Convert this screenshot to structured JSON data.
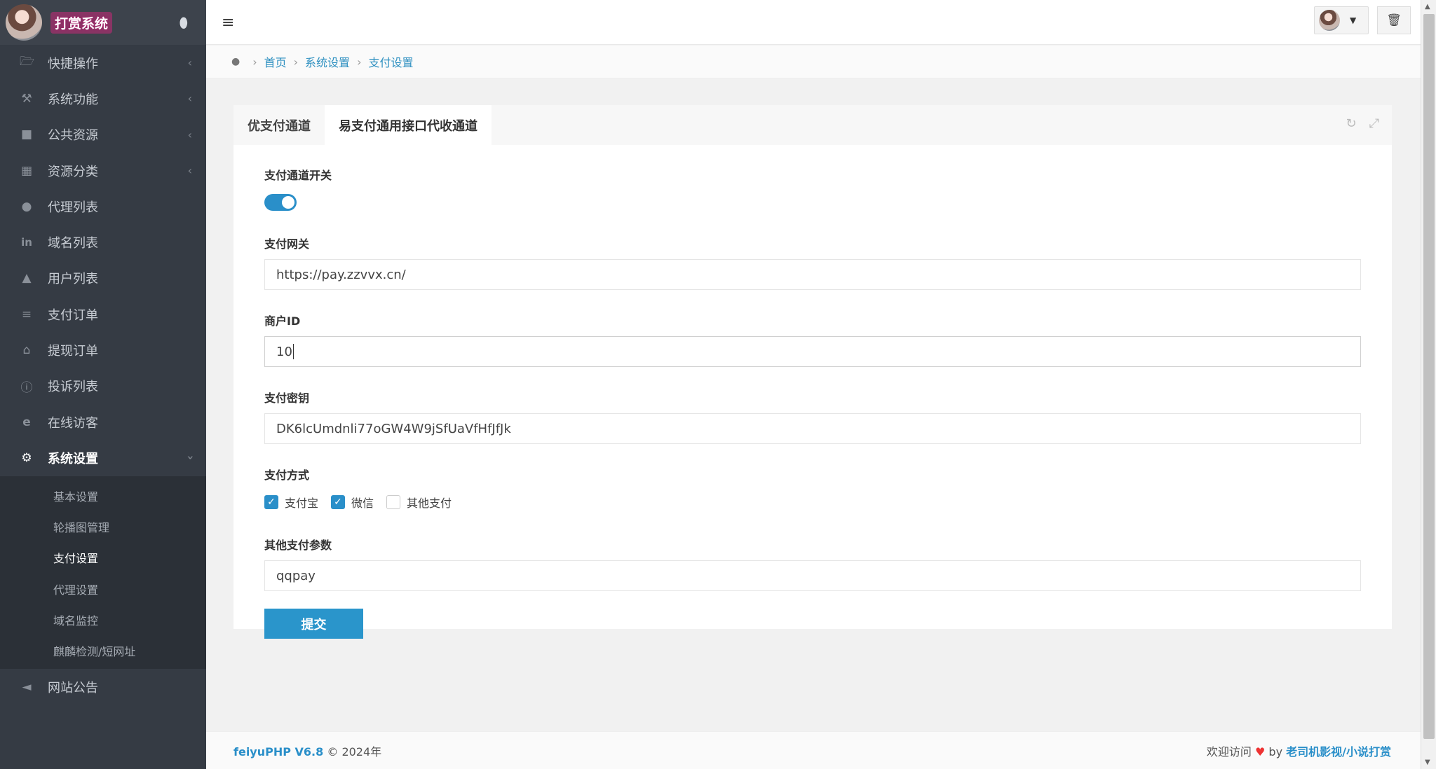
{
  "brand": {
    "title": "打赏系统"
  },
  "sidebar": {
    "items": [
      {
        "label": "快捷操作",
        "icon": "folder-icon",
        "has_arrow": true
      },
      {
        "label": "系统功能",
        "icon": "wrench-icon",
        "has_arrow": true
      },
      {
        "label": "公共资源",
        "icon": "video-camera-icon",
        "has_arrow": true
      },
      {
        "label": "资源分类",
        "icon": "grid-icon",
        "has_arrow": true
      },
      {
        "label": "代理列表",
        "icon": "users-icon",
        "has_arrow": false
      },
      {
        "label": "域名列表",
        "icon": "linkedin-icon",
        "has_arrow": false
      },
      {
        "label": "用户列表",
        "icon": "user-icon",
        "has_arrow": false
      },
      {
        "label": "支付订单",
        "icon": "database-icon",
        "has_arrow": false
      },
      {
        "label": "提现订单",
        "icon": "bank-icon",
        "has_arrow": false
      },
      {
        "label": "投诉列表",
        "icon": "info-icon",
        "has_arrow": false
      },
      {
        "label": "在线访客",
        "icon": "ie-icon",
        "has_arrow": false
      }
    ],
    "active_item": {
      "label": "系统设置",
      "icon": "gear-icon"
    },
    "submenu": [
      {
        "label": "基本设置"
      },
      {
        "label": "轮播图管理"
      },
      {
        "label": "支付设置",
        "current": true
      },
      {
        "label": "代理设置"
      },
      {
        "label": "域名监控"
      },
      {
        "label": "麒麟检测/短网址"
      }
    ],
    "last_item": {
      "label": "网站公告",
      "icon": "bullhorn-icon"
    }
  },
  "breadcrumb": {
    "home": "首页",
    "level1": "系统设置",
    "level2": "支付设置"
  },
  "tabs": [
    {
      "label": "优支付通道",
      "active": false
    },
    {
      "label": "易支付通用接口代收通道",
      "active": true
    }
  ],
  "form": {
    "switch_label": "支付通道开关",
    "switch_on": true,
    "gateway_label": "支付网关",
    "gateway_value": "https://pay.zzvvx.cn/",
    "merchant_label": "商户ID",
    "merchant_value": "10",
    "key_label": "支付密钥",
    "key_value": "DK6lcUmdnli77oGW4W9jSfUaVfHfJfJk",
    "methods_label": "支付方式",
    "methods": [
      {
        "label": "支付宝",
        "checked": true
      },
      {
        "label": "微信",
        "checked": true
      },
      {
        "label": "其他支付",
        "checked": false
      }
    ],
    "other_label": "其他支付参数",
    "other_value": "qqpay",
    "submit_label": "提交"
  },
  "footer": {
    "brand": "feiyuPHP V6.8",
    "copyright": "© 2024年",
    "welcome": "欢迎访问",
    "by": "by",
    "credit": "老司机影视/小说打赏"
  },
  "colors": {
    "accent": "#2a8fc9",
    "sidebar_bg": "#353b44",
    "heart": "#e33333"
  }
}
